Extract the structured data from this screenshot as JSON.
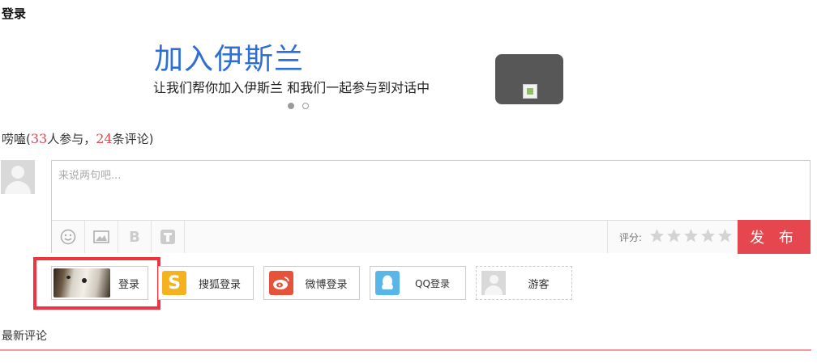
{
  "page": {
    "title": "登录"
  },
  "banner": {
    "title": "加入伊斯兰",
    "subtitle": "让我们帮你加入伊斯兰 和我们一起参与到对话中",
    "slides": 2,
    "active_slide": 1
  },
  "stats": {
    "prefix": "唠嗑(",
    "participants": "33",
    "participants_suffix": "人参与，",
    "comments": "24",
    "comments_suffix": "条评论)"
  },
  "comment": {
    "placeholder": "来说两句吧...",
    "rating_label": "评分:",
    "rating_max": 5,
    "rating_value": 0,
    "publish_label": "发 布",
    "tools": [
      "smiley-icon",
      "image-icon",
      "bold-icon",
      "text-icon"
    ]
  },
  "login": {
    "options": [
      {
        "label": "登录",
        "icon": "user-avatar"
      },
      {
        "label": "搜狐登录",
        "icon": "sohu-icon"
      },
      {
        "label": "微博登录",
        "icon": "weibo-icon"
      },
      {
        "label": "QQ登录",
        "icon": "qq-icon"
      },
      {
        "label": "游客",
        "icon": "guest-avatar"
      }
    ]
  },
  "latest": {
    "title": "最新评论"
  },
  "colors": {
    "accent": "#e6474f",
    "link_blue": "#2d6fd8",
    "highlight": "#ef3340"
  }
}
